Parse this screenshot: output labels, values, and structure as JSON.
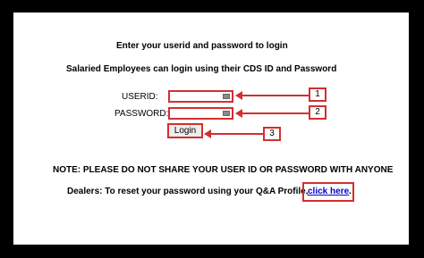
{
  "header": {
    "line1": "Enter your userid and password to login",
    "line2": "Salaried Employees can login using their CDS ID and Password"
  },
  "form": {
    "userid_label": "USERID:",
    "password_label": "PASSWORD:",
    "login_label": "Login",
    "userid_value": "",
    "password_value": ""
  },
  "callouts": [
    "1",
    "2",
    "3"
  ],
  "note": "NOTE: PLEASE DO NOT SHARE YOUR USER ID OR PASSWORD WITH ANYONE",
  "dealers": {
    "text": "Dealers: To reset your password using your Q&A Profile,",
    "link_label": "click here",
    "suffix": "."
  },
  "colors": {
    "accent": "#d32f2f",
    "link": "#0000cc"
  }
}
